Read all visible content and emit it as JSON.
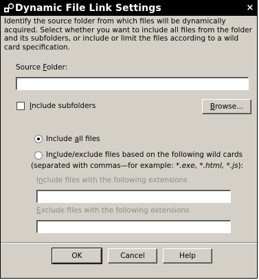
{
  "window": {
    "title": "Dynamic File Link Settings",
    "close_label": "×"
  },
  "description": "Identify the source folder from which files will be dynamically acquired. Select whether you want to include all files from the folder and its subfolders, or include or limit the files according to a wild card specification.",
  "source_folder": {
    "label_prefix": "Source ",
    "label_accel": "F",
    "label_suffix": "older:",
    "value": ""
  },
  "include_subfolders": {
    "accel": "I",
    "label": "nclude subfolders",
    "checked": false
  },
  "browse_button": {
    "accel": "B",
    "label": "rowse..."
  },
  "radio_all": {
    "label_prefix": "Include ",
    "label_accel": "a",
    "label_suffix": "ll files",
    "selected": true
  },
  "radio_wild": {
    "label_prefix": "In",
    "label_accel": "c",
    "label_suffix": "lude/exclude files based on the following wild cards",
    "selected": false,
    "note_prefix": "(separated with commas—for example: ",
    "note_examples": "*.exe, *.html, *.js",
    "note_suffix": "):"
  },
  "include_ext": {
    "label_prefix": "I",
    "label_accel": "n",
    "label_suffix": "clude files with the following extensions",
    "value": ""
  },
  "exclude_ext": {
    "label_accel": "E",
    "label_suffix": "xclude files with the following extensions",
    "value": ""
  },
  "buttons": {
    "ok": "OK",
    "cancel": "Cancel",
    "help": "Help"
  }
}
